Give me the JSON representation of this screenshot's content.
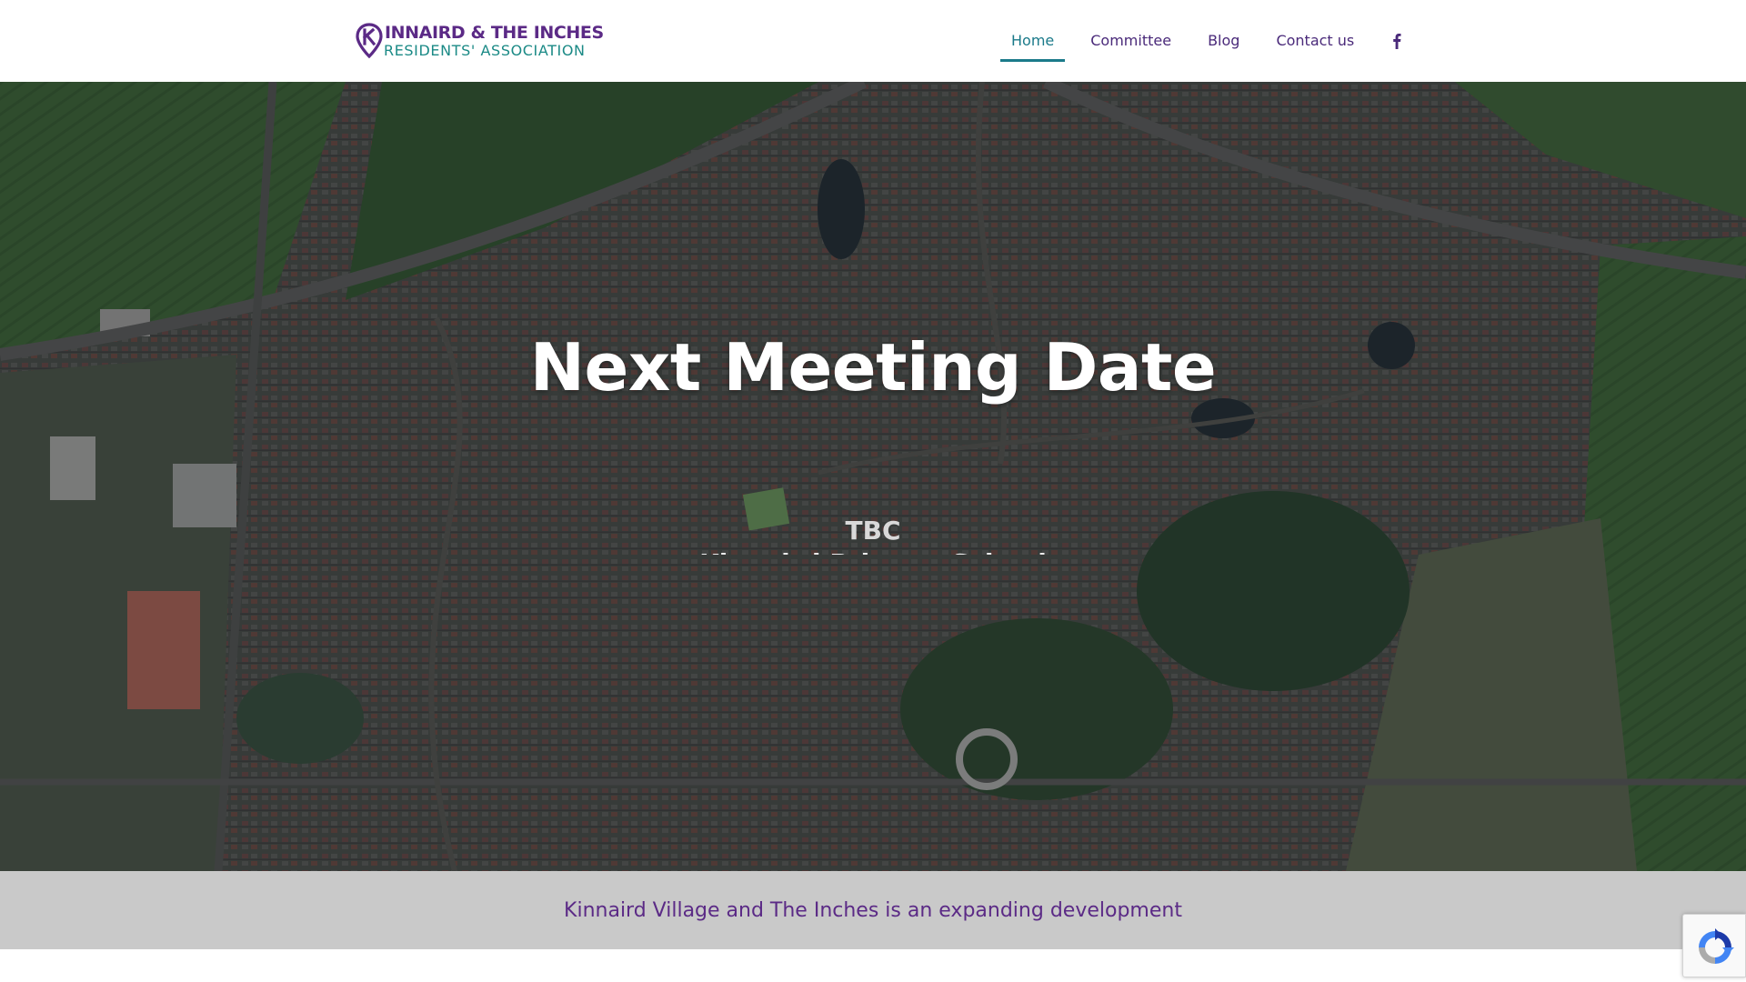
{
  "site": {
    "logo_line1": "INNAIRD & THE INCHES",
    "logo_line2": "RESIDENTS' ASSOCIATION",
    "brand_purple": "#5b2a86",
    "brand_teal": "#1b8a86"
  },
  "nav": {
    "items": [
      {
        "label": "Home",
        "active": true
      },
      {
        "label": "Committee",
        "active": false
      },
      {
        "label": "Blog",
        "active": false
      },
      {
        "label": "Contact us",
        "active": false
      }
    ],
    "social_icon": "facebook-icon"
  },
  "hero": {
    "title": "Next Meeting Date",
    "subtitle": "TBC",
    "subtitle_next": "Kinnaird Primary School"
  },
  "band": {
    "text": "Kinnaird Village and The Inches is an expanding development"
  },
  "badge": {
    "icon": "recaptcha-icon"
  }
}
